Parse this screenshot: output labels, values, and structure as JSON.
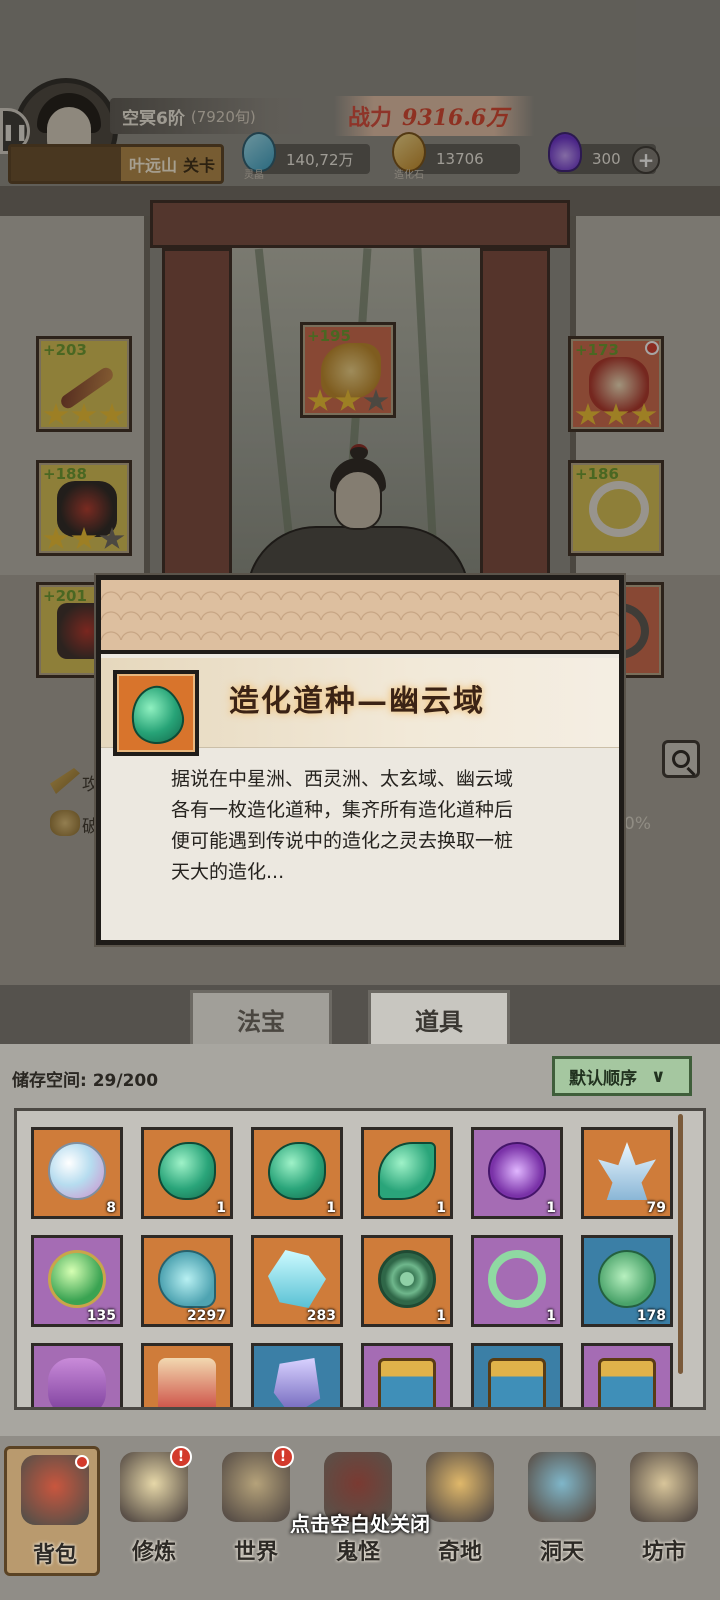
{
  "header": {
    "realm_label": "空冥6阶",
    "realm_detail": "(7920旬)",
    "stage_label": "",
    "player_name": "叶远山",
    "stage_suffix": "关卡",
    "power_label": "战力",
    "power_value": "9316.6万",
    "resources": [
      {
        "icon": "spirit-crystal-icon",
        "label": "灵晶",
        "value": "140,72万",
        "color": "#3aa0c5"
      },
      {
        "icon": "creation-stone-icon",
        "label": "造化石",
        "value": "13706",
        "color": "#c48a28"
      },
      {
        "icon": "purple-flame-icon",
        "label": "",
        "value": "300",
        "color": "#6a2fd1"
      }
    ],
    "add_button": "+"
  },
  "equipment": [
    {
      "bonus": "+203",
      "stars_on": 3,
      "color": "yellow",
      "icon": "chain-whip-icon"
    },
    {
      "bonus": "+195",
      "stars_on": 2,
      "color": "red",
      "icon": "golden-dragon-icon"
    },
    {
      "bonus": "+173",
      "stars_on": 3,
      "color": "red",
      "icon": "red-crown-icon",
      "has_alert": true
    },
    {
      "bonus": "+188",
      "stars_on": 2,
      "color": "yellow",
      "icon": "dark-armor-icon"
    },
    {
      "bonus": "+186",
      "stars_on": 0,
      "color": "yellow",
      "icon": "silver-pendant-icon"
    },
    {
      "bonus": "+201",
      "stars_on": 0,
      "color": "yellow",
      "icon": "boots-icon"
    }
  ],
  "stats": {
    "attack_label": "攻",
    "break_label": "破",
    "right_value": "0%"
  },
  "popup": {
    "title": "造化道种—幽云域",
    "item_icon": "jade-seed-icon",
    "description": "据说在中星洲、西灵洲、太玄域、幽云域各有一枚造化道种，集齐所有造化道种后便可能遇到传说中的造化之灵去换取一桩天大的造化..."
  },
  "tabs": [
    {
      "label": "法宝",
      "active": false
    },
    {
      "label": "道具",
      "active": true
    }
  ],
  "inventory": {
    "storage_label": "储存空间: 29/200",
    "sort_label": "默认顺序",
    "items": [
      {
        "icon": "pearl-orb-icon",
        "count": "8",
        "rarity": "orange"
      },
      {
        "icon": "jade-seed-icon",
        "count": "1",
        "rarity": "orange"
      },
      {
        "icon": "jade-leaf-icon",
        "count": "1",
        "rarity": "orange"
      },
      {
        "icon": "jade-swirl-icon",
        "count": "1",
        "rarity": "orange"
      },
      {
        "icon": "purple-flower-icon",
        "count": "1",
        "rarity": "purple"
      },
      {
        "icon": "ice-crystal-icon",
        "count": "79",
        "rarity": "orange"
      },
      {
        "icon": "thunder-orb-icon",
        "count": "135",
        "rarity": "purple"
      },
      {
        "icon": "water-wave-icon",
        "count": "2297",
        "rarity": "orange"
      },
      {
        "icon": "ice-shard-icon",
        "count": "283",
        "rarity": "orange"
      },
      {
        "icon": "jade-disc-icon",
        "count": "1",
        "rarity": "orange"
      },
      {
        "icon": "jade-ring-icon",
        "count": "1",
        "rarity": "purple"
      },
      {
        "icon": "green-snail-icon",
        "count": "178",
        "rarity": "blue"
      },
      {
        "icon": "purple-cloth-icon",
        "count": "",
        "rarity": "purple"
      },
      {
        "icon": "talisman-scroll-icon",
        "count": "",
        "rarity": "orange"
      },
      {
        "icon": "crystal-shard-icon",
        "count": "",
        "rarity": "blue"
      },
      {
        "icon": "treasure-chest-icon",
        "count": "",
        "rarity": "purple"
      },
      {
        "icon": "treasure-chest-icon",
        "count": "",
        "rarity": "blue"
      },
      {
        "icon": "treasure-chest-icon",
        "count": "",
        "rarity": "purple"
      }
    ]
  },
  "nav": [
    {
      "label": "背包",
      "icon": "backpack-icon",
      "active": true,
      "badge": false
    },
    {
      "label": "修炼",
      "icon": "lotus-icon",
      "active": false,
      "badge": true
    },
    {
      "label": "世界",
      "icon": "scroll-map-icon",
      "active": false,
      "badge": true
    },
    {
      "label": "鬼怪",
      "icon": "demon-icon",
      "active": false,
      "badge": false
    },
    {
      "label": "奇地",
      "icon": "treasure-land-icon",
      "active": false,
      "badge": false
    },
    {
      "label": "洞天",
      "icon": "portal-icon",
      "active": false,
      "badge": false
    },
    {
      "label": "坊市",
      "icon": "market-icon",
      "active": false,
      "badge": false
    }
  ],
  "badge_text": "!",
  "close_hint": "点击空白处关闭"
}
